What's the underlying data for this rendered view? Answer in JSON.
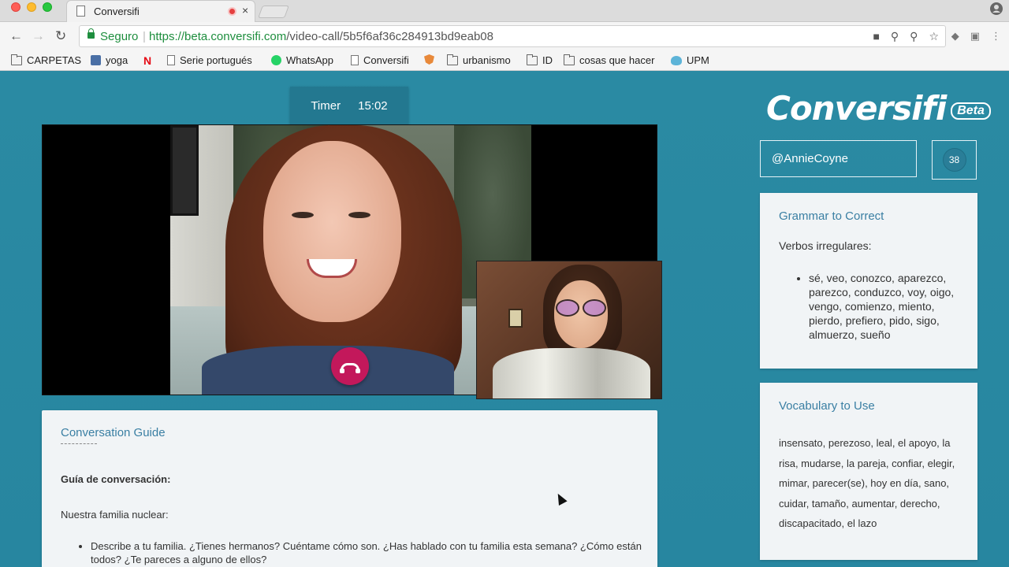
{
  "browser": {
    "tab_title": "Conversifi",
    "tab_close": "×",
    "secure_label": "Seguro",
    "url_host": "https://beta.conversifi.com",
    "url_path": "/video-call/5b5f6af36c284913bd9eab08",
    "bookmarks": [
      {
        "label": "CARPETAS",
        "icon": "folder-icon"
      },
      {
        "label": "yoga",
        "icon": "yoga-icon"
      },
      {
        "label": "",
        "icon": "netflix-icon"
      },
      {
        "label": "Serie portugués",
        "icon": "doc-icon"
      },
      {
        "label": "WhatsApp",
        "icon": "whatsapp-icon"
      },
      {
        "label": "Conversifi",
        "icon": "doc-icon"
      },
      {
        "label": "",
        "icon": "shield-icon"
      },
      {
        "label": "urbanismo",
        "icon": "folder-icon"
      },
      {
        "label": "ID",
        "icon": "folder-icon"
      },
      {
        "label": "cosas que hacer",
        "icon": "folder-icon"
      },
      {
        "label": "UPM",
        "icon": "upm-icon"
      }
    ]
  },
  "timer": {
    "label": "Timer",
    "value": "15:02"
  },
  "logo": {
    "name": "Conversifi",
    "badge": "Beta"
  },
  "user": {
    "username": "@AnnieCoyne",
    "count": "38"
  },
  "grammar": {
    "title": "Grammar to Correct",
    "subtitle": "Verbos irregulares:",
    "items": [
      "sé, veo, conozco, aparezco, parezco, conduzco, voy, oigo, vengo, comienzo, miento, pierdo, prefiero, pido, sigo, almuerzo, sueño"
    ]
  },
  "vocabulary": {
    "title": "Vocabulary to Use",
    "text": "insensato, perezoso, leal, el apoyo, la risa, mudarse, la pareja, confiar, elegir, mimar, parecer(se), hoy en día, sano, cuidar, tamaño, aumentar, derecho, discapacitado, el lazo"
  },
  "guide": {
    "title": "Conversation Guide",
    "heading": "Guía de conversación:",
    "subheading": "Nuestra familia nuclear:",
    "items": [
      "Describe a tu familia. ¿Tienes hermanos? Cuéntame cómo son. ¿Has hablado con tu familia esta semana? ¿Cómo están todos? ¿Te pareces a alguno de ellos?"
    ]
  },
  "colors": {
    "app_background": "#2b8aa3",
    "card_title": "#3a7fa3",
    "hangup": "#c3185b",
    "secure_green": "#1e8e3e"
  }
}
